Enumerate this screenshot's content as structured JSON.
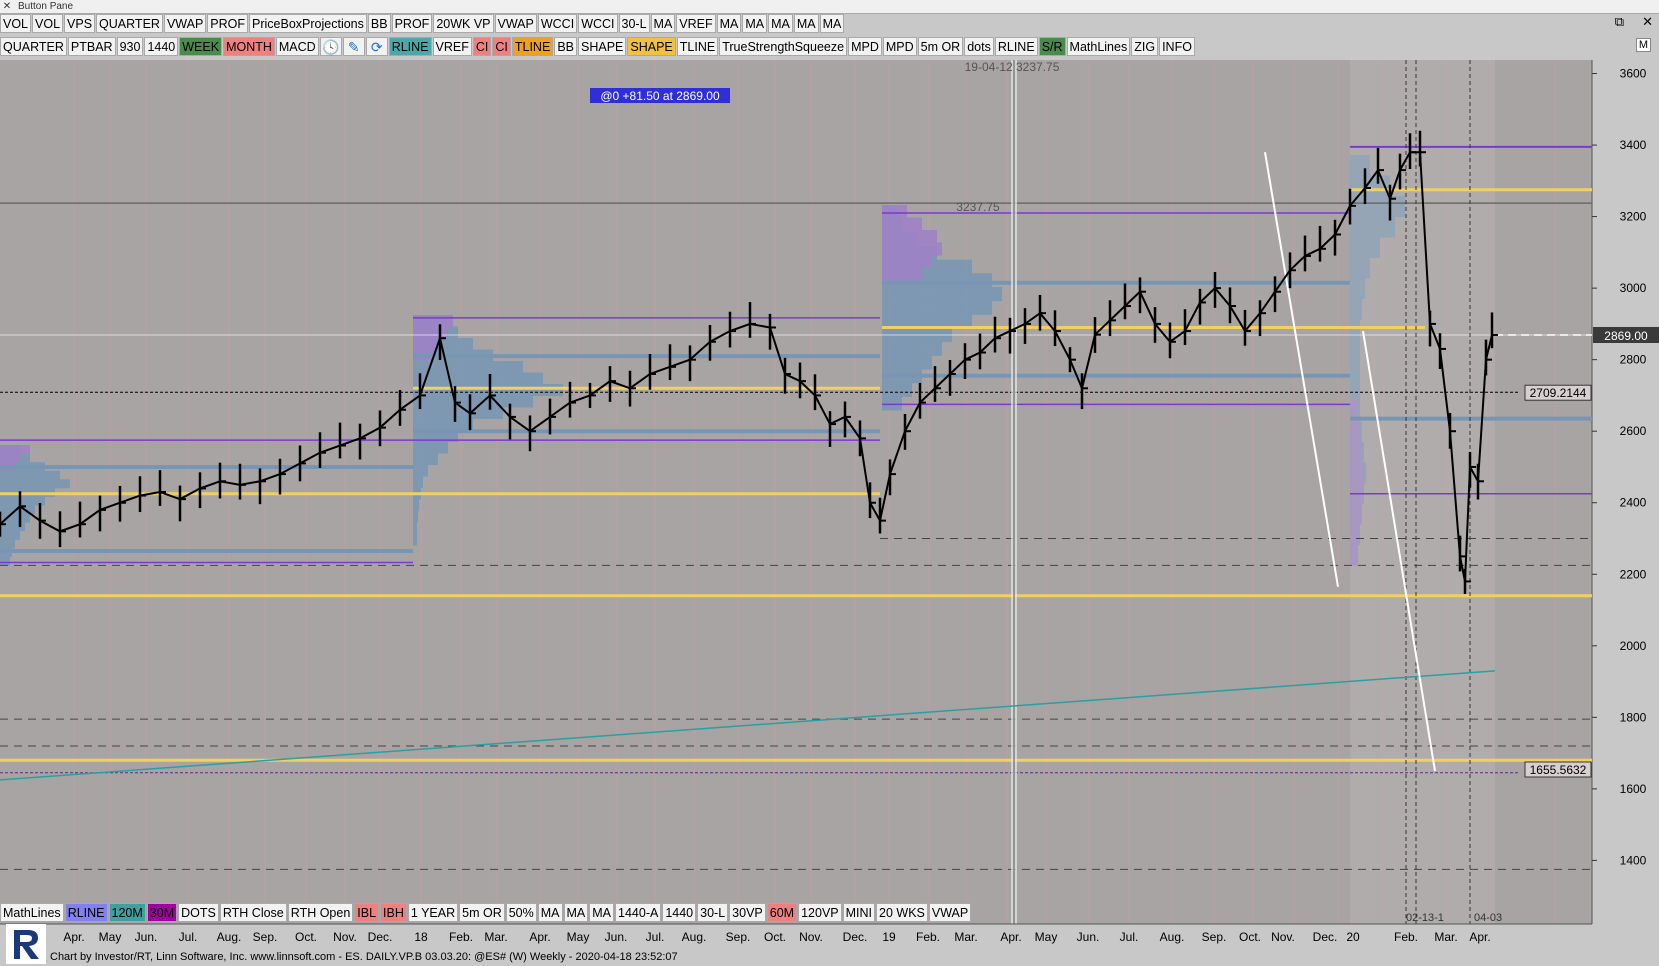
{
  "window": {
    "title": "Button Pane",
    "close_icon": "close-icon"
  },
  "toolbar_row1": [
    "VOL",
    "VOL",
    "VPS",
    "QUARTER",
    "VWAP",
    "PROF",
    "PriceBoxProjections",
    "BB",
    "PROF",
    "20WK VP",
    "VWAP",
    "WCCI",
    "WCCI",
    "30-L",
    "MA",
    "VREF",
    "MA",
    "MA",
    "MA",
    "MA",
    "MA"
  ],
  "toolbar_row2": [
    {
      "label": "QUARTER"
    },
    {
      "label": "PTBAR"
    },
    {
      "label": "930"
    },
    {
      "label": "1440"
    },
    {
      "label": "WEEK",
      "bg": "#4a8a4a",
      "fg": "#000000"
    },
    {
      "label": "MONTH",
      "bg": "#f08080",
      "fg": "#000000"
    },
    {
      "label": "MACD"
    },
    {
      "label": "",
      "icon": "clock-icon"
    },
    {
      "label": "",
      "icon": "pencil-icon"
    },
    {
      "label": "",
      "icon": "refresh-icon"
    },
    {
      "label": "RLINE",
      "bg": "#4aa8a8",
      "fg": "#000000"
    },
    {
      "label": "VREF"
    },
    {
      "label": "CI",
      "bg": "#f08080",
      "fg": "#000000"
    },
    {
      "label": "CI",
      "bg": "#f08080",
      "fg": "#000000"
    },
    {
      "label": "TLINE",
      "bg": "#f0a020",
      "fg": "#000000"
    },
    {
      "label": "BB"
    },
    {
      "label": "SHAPE"
    },
    {
      "label": "SHAPE",
      "bg": "#f0c040",
      "fg": "#000000"
    },
    {
      "label": "TLINE"
    },
    {
      "label": "TrueStrengthSqueeze"
    },
    {
      "label": "MPD"
    },
    {
      "label": "MPD"
    },
    {
      "label": "5m OR"
    },
    {
      "label": "dots"
    },
    {
      "label": "RLINE"
    },
    {
      "label": "S/R",
      "bg": "#4a8a4a",
      "fg": "#000000"
    },
    {
      "label": "MathLines"
    },
    {
      "label": "ZIG"
    },
    {
      "label": "INFO"
    }
  ],
  "toolbar_row3": [
    {
      "label": "MathLines"
    },
    {
      "label": "RLINE",
      "bg": "#8080f0",
      "fg": "#000000"
    },
    {
      "label": "120M",
      "bg": "#40a0a0",
      "fg": "#000000"
    },
    {
      "label": "30M",
      "bg": "#a000a0",
      "fg": "#000000"
    },
    {
      "label": "DOTS"
    },
    {
      "label": "RTH Close"
    },
    {
      "label": "RTH Open"
    },
    {
      "label": "IBL",
      "bg": "#f08080",
      "fg": "#000000"
    },
    {
      "label": "IBH",
      "bg": "#f08080",
      "fg": "#000000"
    },
    {
      "label": "1 YEAR"
    },
    {
      "label": "5m OR"
    },
    {
      "label": "50%"
    },
    {
      "label": "MA"
    },
    {
      "label": "MA"
    },
    {
      "label": "MA"
    },
    {
      "label": "1440-A"
    },
    {
      "label": "1440"
    },
    {
      "label": "30-L"
    },
    {
      "label": "30VP"
    },
    {
      "label": "60M",
      "bg": "#f08080",
      "fg": "#000000"
    },
    {
      "label": "120VP"
    },
    {
      "label": "MINI"
    },
    {
      "label": "20 WKS"
    },
    {
      "label": "VWAP"
    }
  ],
  "window_controls": {
    "restore": "⧉",
    "close": "✕",
    "badge": "M"
  },
  "chart": {
    "price_axis": [
      "3600",
      "3400",
      "3200",
      "3000",
      "2800",
      "2600",
      "2400",
      "2200",
      "2000",
      "1800",
      "1600",
      "1400"
    ],
    "last_price_label": "2869.00",
    "level_labels": [
      "2709.2144",
      "1655.5632"
    ],
    "info_box": "@0  +81.50 at 2869.00",
    "cursor_label": "19-04-12  3237.75",
    "price_tag": "3237.75",
    "date_labels": [
      "02-13-1",
      "04-03"
    ],
    "x_axis": [
      "Apr.",
      "May",
      "Jun.",
      "Jul.",
      "Aug.",
      "Sep.",
      "Oct.",
      "Nov.",
      "Dec.",
      "18",
      "Feb.",
      "Mar.",
      "Apr.",
      "May",
      "Jun.",
      "Jul.",
      "Aug.",
      "Sep.",
      "Oct.",
      "Nov.",
      "Dec.",
      "19",
      "Feb.",
      "Mar.",
      "Apr.",
      "May",
      "Jun.",
      "Jul.",
      "Aug.",
      "Sep.",
      "Oct.",
      "Nov.",
      "Dec.",
      "20",
      "Feb.",
      "Mar.",
      "Apr."
    ],
    "colors": {
      "plot_bg": "#a8a4a4",
      "bar": "#000000",
      "level_yellow": "#f0d060",
      "level_purple": "#7a3ad0",
      "profile_blue": "#7896b4",
      "profile_purple": "#a080c8",
      "ma": "#2aa0a0"
    }
  },
  "footer": "Chart by Investor/RT, Linn Software, Inc. www.linnsoft.com - ES. DAILY.VP.B   03.03.20: @ES# (W) Weekly - 2020-04-18 23:52:07"
}
